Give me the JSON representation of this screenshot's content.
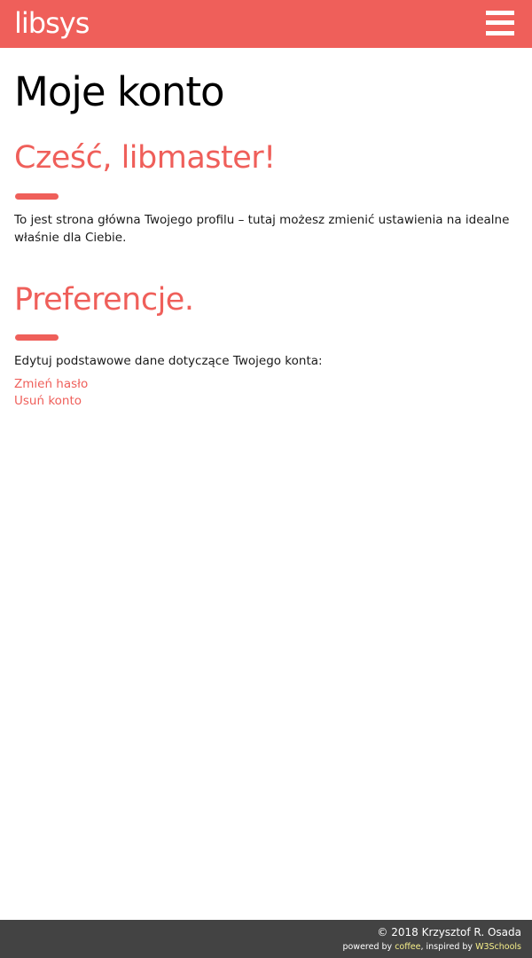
{
  "header": {
    "logo": "libsys",
    "menu_icon": "hamburger-menu-icon",
    "background_color": "#ef5f5a"
  },
  "main": {
    "page_title": "Moje konto",
    "greeting": {
      "heading": "Cześć, libmaster!",
      "text": "To jest strona główna Twojego profilu – tutaj możesz zmienić ustawienia na idealne właśnie dla Ciebie."
    },
    "preferences": {
      "heading": "Preferencje.",
      "text": "Edytuj podstawowe dane dotyczące Twojego konta:",
      "links": [
        {
          "label": "Zmień hasło"
        },
        {
          "label": "Usuń konto"
        }
      ]
    },
    "accent_color": "#ef5f5a"
  },
  "footer": {
    "copyright": "© 2018 Krzysztof R. Osada",
    "powered_prefix": "powered by ",
    "powered_link": "coffee",
    "inspired_prefix": ", inspired by ",
    "inspired_link": "W3Schools",
    "background_color": "#434343",
    "link_color": "#f7f08a"
  }
}
